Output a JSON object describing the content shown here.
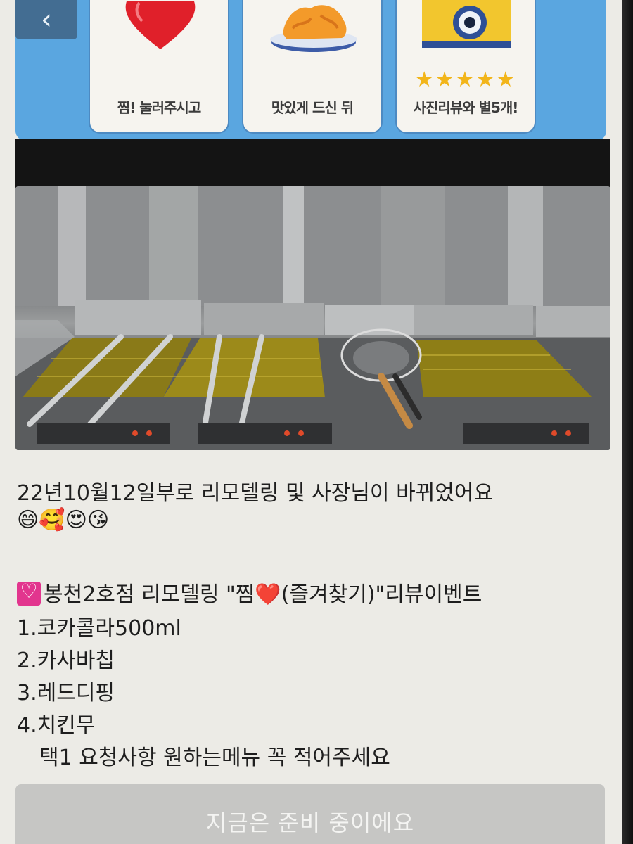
{
  "nav": {
    "back_icon": "chevron-left-icon",
    "back_glyph": "‹"
  },
  "banner": {
    "cards": [
      {
        "icon": "heart-icon",
        "label": "찜! 눌러주시고"
      },
      {
        "icon": "fried-chicken-basket-icon",
        "label": "맛있게 드신 뒤"
      },
      {
        "icon": "camera-icon",
        "label": "사진리뷰와 별5개!"
      }
    ],
    "stars": [
      "★",
      "★",
      "★",
      "★",
      "★"
    ],
    "colors": {
      "background": "#5aa6e0",
      "heart": "#e0202a",
      "star": "#f2b51a",
      "camera": "#f2c62e"
    }
  },
  "post": {
    "photo_alt": "fryer-station-photo",
    "line1": "22년10월12일부로 리모델링 및 사장님이 바뀌었어요",
    "emojis": "😄🥰😍😘",
    "event_title_prefix": "봉천2호점 리모델링 \"찜",
    "event_title_heart": "❤️",
    "event_title_suffix": "(즐겨찾기)\"리뷰이벤트",
    "options": [
      "1.코카콜라500ml",
      "2.카사바칩",
      "3.레드디핑",
      "4.치킨무"
    ],
    "note": "택1 요청사항 원하는메뉴 꼭 적어주세요"
  },
  "footer": {
    "status_button": "지금은 준비 중이에요"
  }
}
